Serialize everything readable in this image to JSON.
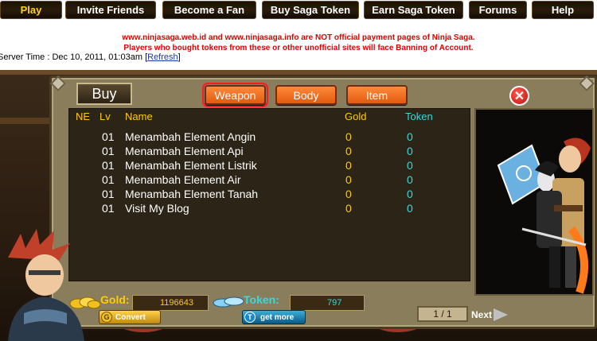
{
  "nav": {
    "items": [
      {
        "label": "Play",
        "active": true
      },
      {
        "label": "Invite Friends"
      },
      {
        "label": "Become a Fan"
      },
      {
        "label": "Buy Saga Token"
      },
      {
        "label": "Earn Saga Token"
      },
      {
        "label": "Forums"
      },
      {
        "label": "Help"
      }
    ]
  },
  "notice": {
    "line1": "www.ninjasaga.web.id and www.ninjasaga.info are NOT official payment pages of Ninja Saga.",
    "line2": "Players who bought tokens from these or other unofficial sites will face Banning of Account."
  },
  "server_time": {
    "text": "Server Time : Dec 10, 2011, 01:03am ",
    "refresh": "Refresh"
  },
  "shop": {
    "title": "Buy",
    "tabs": [
      "Weapon",
      "Body",
      "Item"
    ],
    "selected_tab": "Weapon",
    "columns": {
      "ne": "NE",
      "lv": "Lv",
      "name": "Name",
      "gold": "Gold",
      "token": "Token"
    },
    "items": [
      {
        "lv": "01",
        "name": "Menambah Element Angin",
        "gold": "0",
        "token": "0"
      },
      {
        "lv": "01",
        "name": "Menambah Element Api",
        "gold": "0",
        "token": "0"
      },
      {
        "lv": "01",
        "name": "Menambah Element Listrik",
        "gold": "0",
        "token": "0"
      },
      {
        "lv": "01",
        "name": "Menambah Element Air",
        "gold": "0",
        "token": "0"
      },
      {
        "lv": "01",
        "name": "Menambah Element Tanah",
        "gold": "0",
        "token": "0"
      },
      {
        "lv": "01",
        "name": "Visit My Blog",
        "gold": "0",
        "token": "0"
      }
    ],
    "gold_label": "Gold:",
    "gold_value": "1196643",
    "token_label": "Token:",
    "token_value": "797",
    "convert_label": "Convert",
    "get_more_label": "get more",
    "page": "1 / 1",
    "next_label": "Next"
  },
  "colors": {
    "gold": "#ffcc00",
    "token": "#3ad8d8",
    "alert": "#e00000",
    "tab": "#ff7a2a"
  }
}
